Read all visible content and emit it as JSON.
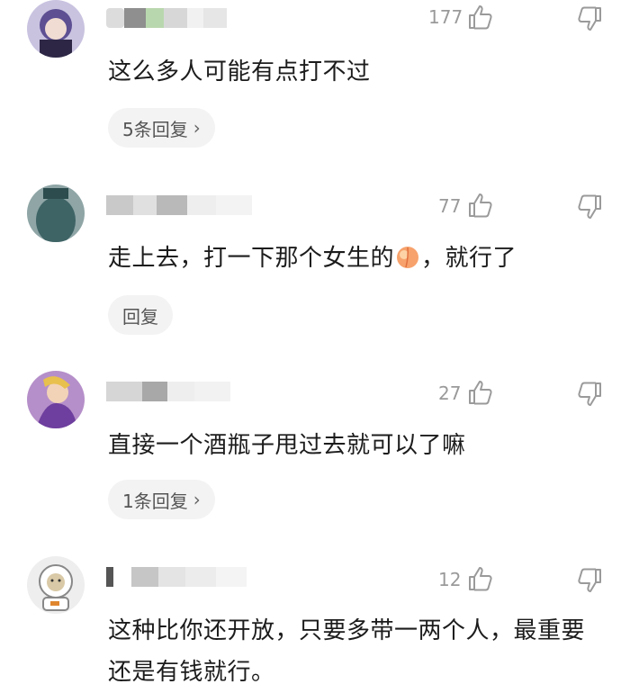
{
  "comments": [
    {
      "likes": "177",
      "text": "这么多人可能有点打不过",
      "reply_label": "5条回复",
      "avatar_icon": "anime-girl-avatar"
    },
    {
      "likes": "77",
      "text_before": "走上去，打一下那个女生的",
      "emoji": "peach-emoji",
      "text_after": "，就行了",
      "reply_label": "回复",
      "avatar_icon": "vase-avatar"
    },
    {
      "likes": "27",
      "text": "直接一个酒瓶子甩过去就可以了嘛",
      "reply_label": "1条回复",
      "avatar_icon": "game-character-avatar"
    },
    {
      "likes": "12",
      "text": "这种比你还开放，只要多带一两个人，最重要还是有钱就行。",
      "avatar_icon": "astronaut-meme-avatar"
    }
  ],
  "icons": {
    "like": "thumbs-up-icon",
    "dislike": "thumbs-down-icon",
    "chevron": "chevron-right-icon"
  },
  "colors": {
    "meta": "#9a9a9a",
    "reply_bg": "#f3f3f3"
  }
}
